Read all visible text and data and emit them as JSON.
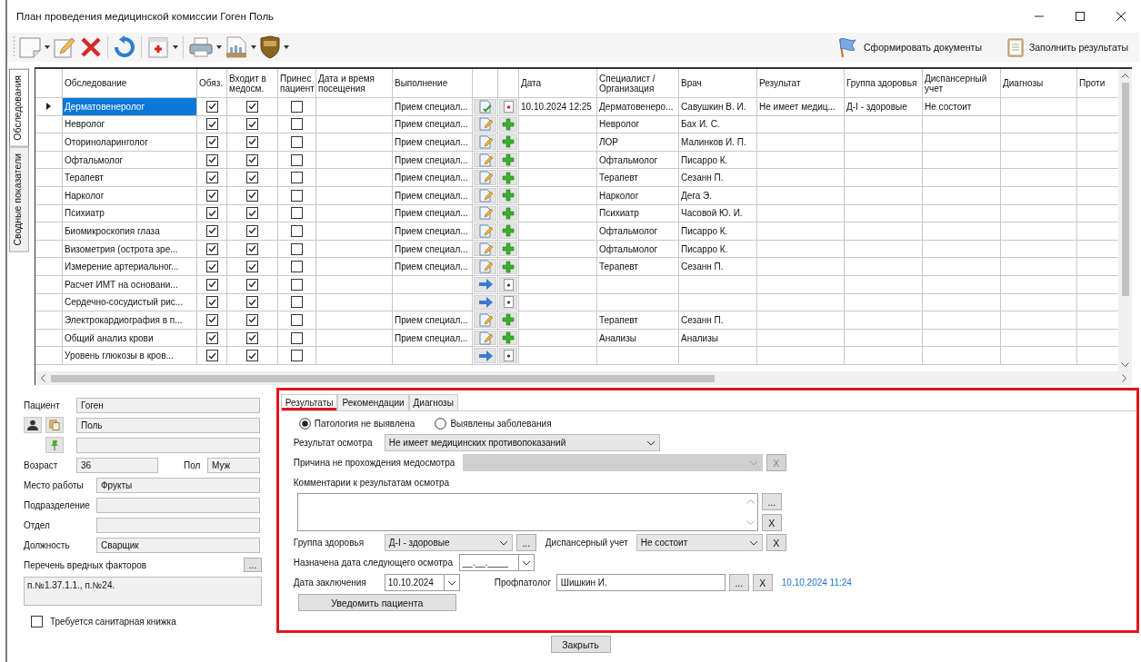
{
  "window": {
    "title": "План проведения медицинской комиссии Гоген Поль"
  },
  "toolbar": {
    "buttons": [
      {
        "label": "Сформировать документы",
        "kind": "flag"
      },
      {
        "label": "Заполнить результаты",
        "kind": "clipboard"
      }
    ]
  },
  "side_tabs": [
    {
      "label": "Обследования",
      "selected": true
    },
    {
      "label": "Сводные показатели",
      "selected": false
    }
  ],
  "table": {
    "columns": [
      "Обследование",
      "Обяз.",
      "Входит в медосм.",
      "Принес пациент",
      "Дата и время посещения",
      "Выполнение",
      "Дата",
      "Специалист / Организация",
      "Врач",
      "Результат",
      "Группа здоровья",
      "Диспансерный учет",
      "Диагнозы",
      "Проти"
    ],
    "rows": [
      {
        "selected": true,
        "name": "Дерматовенеролог",
        "required": true,
        "included": true,
        "brought": false,
        "execution": "Прием специал...",
        "kind": "done",
        "date": "10.10.2024 12:25",
        "specialist": "Дерматовенеро...",
        "doctor": "Савушкин В. И.",
        "result": "Не имеет медиц...",
        "group": "Д-I - здоровые",
        "dispensary": "Не состоит"
      },
      {
        "selected": false,
        "name": "Невролог",
        "required": true,
        "included": true,
        "brought": false,
        "execution": "Прием специал...",
        "kind": "planned",
        "specialist": "Невролог",
        "doctor": "Бах И. С."
      },
      {
        "selected": false,
        "name": "Оториноларинголог",
        "required": true,
        "included": true,
        "brought": false,
        "execution": "Прием специал...",
        "kind": "planned",
        "specialist": "ЛОР",
        "doctor": "Малинков И. П."
      },
      {
        "selected": false,
        "name": "Офтальмолог",
        "required": true,
        "included": true,
        "brought": false,
        "execution": "Прием специал...",
        "kind": "planned",
        "specialist": "Офтальмолог",
        "doctor": "Писарро К."
      },
      {
        "selected": false,
        "name": "Терапевт",
        "required": true,
        "included": true,
        "brought": false,
        "execution": "Прием специал...",
        "kind": "planned",
        "specialist": "Терапевт",
        "doctor": "Сезанн П."
      },
      {
        "selected": false,
        "name": "Нарколог",
        "required": true,
        "included": true,
        "brought": false,
        "execution": "Прием специал...",
        "kind": "planned",
        "specialist": "Нарколог",
        "doctor": "Дега Э."
      },
      {
        "selected": false,
        "name": "Психиатр",
        "required": true,
        "included": true,
        "brought": false,
        "execution": "Прием специал...",
        "kind": "planned",
        "specialist": "Психиатр",
        "doctor": "Часовой Ю. И."
      },
      {
        "selected": false,
        "name": "Биомикроскопия глаза",
        "required": true,
        "included": true,
        "brought": false,
        "execution": "Прием специал...",
        "kind": "planned",
        "specialist": "Офтальмолог",
        "doctor": "Писарро К."
      },
      {
        "selected": false,
        "name": "Визометрия (острота зре...",
        "required": true,
        "included": true,
        "brought": false,
        "execution": "Прием специал...",
        "kind": "planned",
        "specialist": "Офтальмолог",
        "doctor": "Писарро К."
      },
      {
        "selected": false,
        "name": "Измерение артериальног...",
        "required": true,
        "included": true,
        "brought": false,
        "execution": "Прием специал...",
        "kind": "planned",
        "specialist": "Терапевт",
        "doctor": "Сезанн П."
      },
      {
        "selected": false,
        "name": "Расчет ИМТ на основани...",
        "required": true,
        "included": true,
        "brought": false,
        "kind": "calculated"
      },
      {
        "selected": false,
        "name": "Сердечно-сосудистый рис...",
        "required": true,
        "included": true,
        "brought": false,
        "kind": "calculated"
      },
      {
        "selected": false,
        "name": "Электрокардиография в п...",
        "required": true,
        "included": true,
        "brought": false,
        "execution": "Прием специал...",
        "kind": "planned",
        "specialist": "Терапевт",
        "doctor": "Сезанн П."
      },
      {
        "selected": false,
        "name": "Общий анализ крови",
        "required": true,
        "included": true,
        "brought": false,
        "execution": "Прием специал...",
        "kind": "planned",
        "specialist": "Анализы",
        "doctor": "Анализы"
      },
      {
        "selected": false,
        "name": "Уровень глюкозы в кров...",
        "required": true,
        "included": true,
        "brought": false,
        "kind": "calculated"
      }
    ]
  },
  "patient": {
    "label": "Пациент",
    "last_name": "Гоген",
    "first_name": "Поль",
    "age_label": "Возраст",
    "age": "36",
    "sex_label": "Пол",
    "sex": "Муж",
    "work": [
      {
        "label": "Место работы",
        "value": "Фрукты"
      },
      {
        "label": "Подразделение"
      },
      {
        "label": "Отдел"
      },
      {
        "label": "Должность",
        "value": "Сварщик"
      }
    ],
    "factors_label": "Перечень вредных факторов",
    "factors_button": "...",
    "factors": "п.№1.37.1.1., п.№24.",
    "sanitary_book": {
      "label": "Требуется санитарная книжка",
      "checked": false
    }
  },
  "result_tabs": [
    {
      "label": "Результаты",
      "selected": true
    },
    {
      "label": "Рекомендации",
      "selected": false
    },
    {
      "label": "Диагнозы",
      "selected": false
    }
  ],
  "results": {
    "outcome": [
      {
        "label": "Патология не выявлена",
        "selected": true
      },
      {
        "label": "Выявлены заболевания",
        "selected": false
      }
    ],
    "exam_result": {
      "label": "Результат осмотра",
      "value": "Не имеет медицинских противопоказаний"
    },
    "reason": {
      "label": "Причина не прохождения медосмотра",
      "disabled": true,
      "clear": "X"
    },
    "comments": {
      "label": "Комментарии к результатам осмотра",
      "more": "...",
      "clear": "X"
    },
    "health_group": {
      "label": "Группа здоровья",
      "value": "Д-I - здоровые",
      "more": "..."
    },
    "dispensary": {
      "label": "Диспансерный учет",
      "value": "Не состоит",
      "clear": "X"
    },
    "next_exam": {
      "label": "Назначена дата следующего осмотра",
      "value": "__.__.____"
    },
    "conclusion_date": {
      "label": "Дата заключения",
      "value": "10.10.2024"
    },
    "pathologist": {
      "label": "Профпатолог",
      "value": "Шишкин И.",
      "more": "...",
      "clear": "X",
      "timestamp": "10.10.2024 11:24"
    },
    "notify_button": "Уведомить пациента"
  },
  "close_button": "Закрыть"
}
